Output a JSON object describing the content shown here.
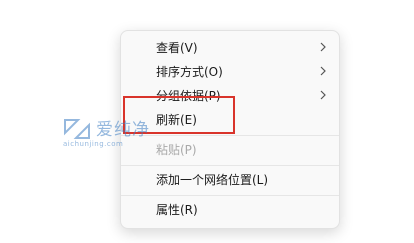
{
  "context_menu": {
    "items": [
      {
        "label": "查看(V)",
        "submenu": true
      },
      {
        "label": "排序方式(O)",
        "submenu": true
      },
      {
        "label": "分组依据(P)",
        "submenu": true
      },
      {
        "label": "刷新(E)",
        "submenu": false
      },
      {
        "label": "粘贴(P)",
        "submenu": false,
        "disabled": true
      },
      {
        "label": "添加一个网络位置(L)",
        "submenu": false
      },
      {
        "label": "属性(R)",
        "submenu": false
      }
    ]
  },
  "watermark": {
    "title": "爱纯净",
    "subtitle": "aichunjing.com"
  },
  "colors": {
    "highlight_box": "#d9342b",
    "watermark": "#3f7fc4"
  }
}
